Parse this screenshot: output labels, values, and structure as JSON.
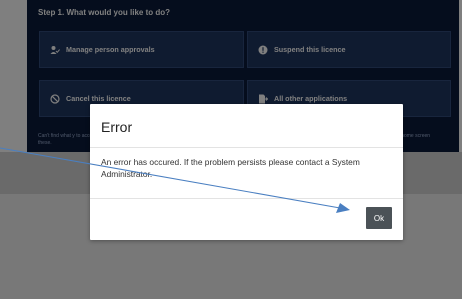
{
  "step": {
    "title": "Step 1. What would you like to do?",
    "tiles": [
      {
        "label": "Manage person approvals",
        "icon": "person-check-icon"
      },
      {
        "label": "Suspend this licence",
        "icon": "alert-circle-icon"
      },
      {
        "label": "Cancel this licence",
        "icon": "cancel-circle-icon"
      },
      {
        "label": "All other applications",
        "icon": "document-arrow-icon"
      }
    ],
    "note_left": "Can't find what y to access these.",
    "note_right": "e home screen"
  },
  "modal": {
    "title": "Error",
    "message": "An error has occured. If the problem persists please contact a System Administrator.",
    "ok_label": "Ok"
  },
  "colors": {
    "panel": "#0b1a3a",
    "tile": "#1f3761",
    "arrow": "#4a7fc1",
    "ok_button": "#4b5257"
  }
}
